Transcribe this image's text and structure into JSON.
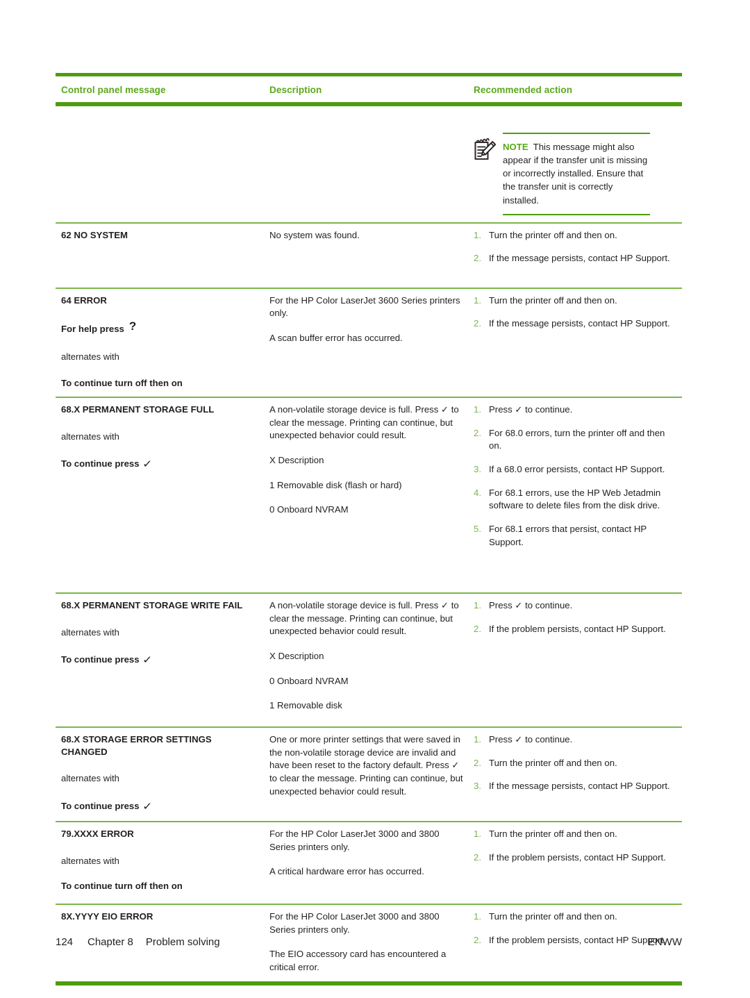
{
  "page": {
    "footer": {
      "page_number": "124",
      "chapter": "Chapter 8",
      "section_title": "Problem solving",
      "right_label": "ENWW"
    },
    "colors": {
      "rule_dark_green": "#4e9d0c",
      "rule_light_green": "#7ab648",
      "header_text_green": "#5aa81b",
      "list_number_green": "#7ab648",
      "body_text": "#231f20"
    }
  },
  "table": {
    "headers": {
      "col1": "Control panel message",
      "col2": "Description",
      "col3": "Recommended action"
    },
    "note_row": {
      "icon": "note-pencil-icon",
      "label": "NOTE",
      "text": "This message might also appear if the transfer unit is missing or incorrectly installed. Ensure that the transfer unit is correctly installed."
    },
    "rows": [
      {
        "message": {
          "title": "62 NO SYSTEM",
          "alternates_label": "",
          "sub": "",
          "sub_glyph": ""
        },
        "description": [
          "No system was found."
        ],
        "actions": [
          {
            "num": "1.",
            "text": "Turn the printer off and then on."
          },
          {
            "num": "2.",
            "text": "If the message persists, contact HP Support."
          }
        ]
      },
      {
        "message": {
          "title": "64 ERROR",
          "help_line": "For help press",
          "help_glyph": "?",
          "alternates_label": "alternates with",
          "sub": "To continue turn off then on",
          "sub_glyph": ""
        },
        "description": [
          "For the HP Color LaserJet 3600 Series printers only.",
          "A scan buffer error has occurred."
        ],
        "actions": [
          {
            "num": "1.",
            "text": "Turn the printer off and then on."
          },
          {
            "num": "2.",
            "text": "If the message persists, contact HP Support."
          }
        ]
      },
      {
        "message": {
          "title": "68.X PERMANENT STORAGE FULL",
          "alternates_label": "alternates with",
          "sub": "To continue press",
          "sub_glyph": "✓"
        },
        "description": [
          "A non-volatile storage device is full. Press ✓ to clear the message. Printing can continue, but unexpected behavior could result.",
          "X Description",
          "1 Removable disk (flash or hard)",
          "0 Onboard NVRAM"
        ],
        "actions": [
          {
            "num": "1.",
            "text": "Press ✓ to continue."
          },
          {
            "num": "2.",
            "text": "For 68.0 errors, turn the printer off and then on."
          },
          {
            "num": "3.",
            "text": "If a 68.0 error persists, contact HP Support."
          },
          {
            "num": "4.",
            "text": "For 68.1 errors, use the HP Web Jetadmin software to delete files from the disk drive."
          },
          {
            "num": "5.",
            "text": "For 68.1 errors that persist, contact HP Support."
          }
        ]
      },
      {
        "message": {
          "title": "68.X PERMANENT STORAGE WRITE FAIL",
          "alternates_label": "alternates with",
          "sub": "To continue press",
          "sub_glyph": "✓"
        },
        "description": [
          "A non-volatile storage device is full. Press ✓ to clear the message. Printing can continue, but unexpected behavior could result.",
          "X Description",
          "0 Onboard NVRAM",
          "1 Removable disk"
        ],
        "actions": [
          {
            "num": "1.",
            "text": "Press ✓ to continue."
          },
          {
            "num": "2.",
            "text": "If the problem persists, contact HP Support."
          }
        ]
      },
      {
        "message": {
          "title": "68.X STORAGE ERROR SETTINGS CHANGED",
          "alternates_label": "alternates with",
          "sub": "To continue press",
          "sub_glyph": "✓"
        },
        "description": [
          "One or more printer settings that were saved in the non-volatile storage device are invalid and have been reset to the factory default. Press ✓ to clear the message. Printing can continue, but unexpected behavior could result."
        ],
        "actions": [
          {
            "num": "1.",
            "text": "Press ✓ to continue."
          },
          {
            "num": "2.",
            "text": "Turn the printer off and then on."
          },
          {
            "num": "3.",
            "text": "If the message persists, contact HP Support."
          }
        ]
      },
      {
        "message": {
          "title": "79.XXXX ERROR",
          "alternates_label": "alternates with",
          "sub": "To continue turn off then on",
          "sub_glyph": ""
        },
        "description": [
          "For the HP Color LaserJet 3000 and 3800 Series printers only.",
          "A critical hardware error has occurred."
        ],
        "actions": [
          {
            "num": "1.",
            "text": "Turn the printer off and then on."
          },
          {
            "num": "2.",
            "text": "If the problem persists, contact HP Support."
          }
        ]
      },
      {
        "message": {
          "title": "8X.YYYY EIO ERROR",
          "alternates_label": "",
          "sub": "",
          "sub_glyph": ""
        },
        "description": [
          "For the HP Color LaserJet 3000 and 3800 Series printers only.",
          "The EIO accessory card has encountered a critical error."
        ],
        "actions": [
          {
            "num": "1.",
            "text": "Turn the printer off and then on."
          },
          {
            "num": "2.",
            "text": "If the problem persists, contact HP Support."
          }
        ]
      }
    ]
  }
}
